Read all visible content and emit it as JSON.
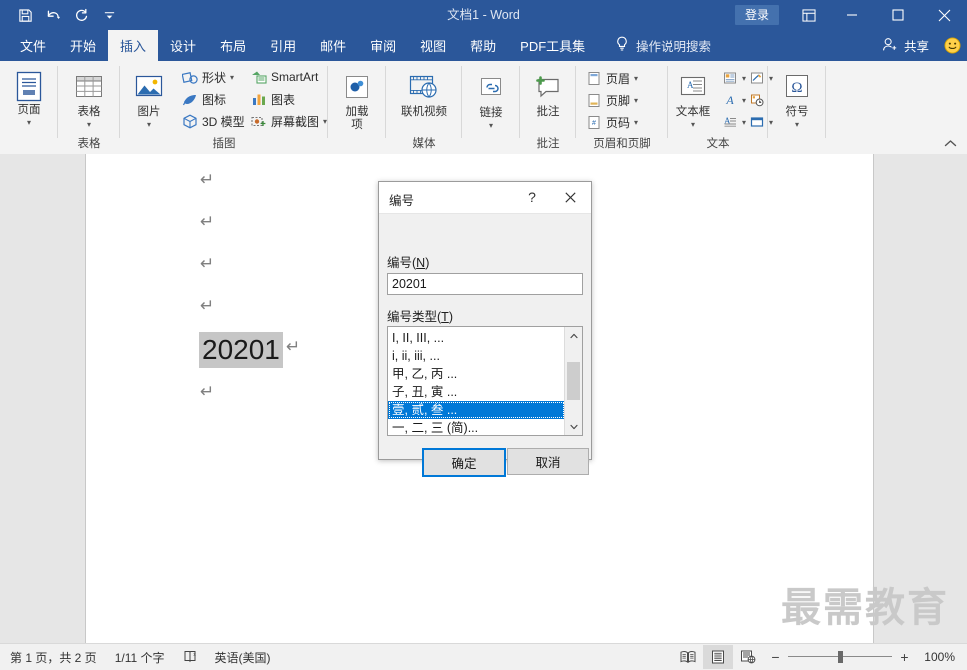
{
  "titlebar": {
    "document_title": "文档1  -  Word",
    "signin_label": "登录",
    "quick_access": [
      {
        "name": "save",
        "label": "保存"
      },
      {
        "name": "undo",
        "label": "撤消"
      },
      {
        "name": "redo",
        "label": "恢复"
      },
      {
        "name": "customize",
        "label": "自定义快速访问工具栏"
      }
    ],
    "ribbon_display_label": "功能区显示选项",
    "minimize_label": "最小化",
    "maximize_label": "最大化",
    "close_label": "关闭"
  },
  "tabs": [
    {
      "label": "文件",
      "active": false
    },
    {
      "label": "开始",
      "active": false
    },
    {
      "label": "插入",
      "active": true
    },
    {
      "label": "设计",
      "active": false
    },
    {
      "label": "布局",
      "active": false
    },
    {
      "label": "引用",
      "active": false
    },
    {
      "label": "邮件",
      "active": false
    },
    {
      "label": "审阅",
      "active": false
    },
    {
      "label": "视图",
      "active": false
    },
    {
      "label": "帮助",
      "active": false
    },
    {
      "label": "PDF工具集",
      "active": false
    }
  ],
  "tellme": {
    "placeholder": "操作说明搜索"
  },
  "share": {
    "label": "共享"
  },
  "ribbon": {
    "groups": [
      {
        "name": "pages",
        "label": "",
        "big": [
          {
            "name": "pages-button",
            "label": "页面",
            "caret": "▾"
          }
        ]
      },
      {
        "name": "tables",
        "label": "表格",
        "big": [
          {
            "name": "table-button",
            "label": "表格",
            "caret": "▾"
          }
        ]
      },
      {
        "name": "illustrations",
        "label": "插图",
        "big": [
          {
            "name": "pictures-button",
            "label": "图片",
            "caret": "▾"
          }
        ],
        "small": [
          {
            "name": "shapes",
            "label": "形状",
            "caret": "▾"
          },
          {
            "name": "smartart",
            "label": "SmartArt",
            "caret": ""
          },
          {
            "name": "icons",
            "label": "图标",
            "caret": ""
          },
          {
            "name": "chart",
            "label": "图表",
            "caret": ""
          },
          {
            "name": "model-3d",
            "label": "3D 模型",
            "caret": ""
          },
          {
            "name": "screenshot",
            "label": "屏幕截图",
            "caret": "▾"
          }
        ]
      },
      {
        "name": "addins",
        "label": "",
        "big": [
          {
            "name": "addins-button",
            "label": "加载项",
            "caret": "▾"
          }
        ]
      },
      {
        "name": "media",
        "label": "媒体",
        "big": [
          {
            "name": "online-video-button",
            "label": "联机视频",
            "caret": ""
          }
        ]
      },
      {
        "name": "links",
        "label": "",
        "big": [
          {
            "name": "link-button",
            "label": "链接",
            "caret": "▾"
          }
        ]
      },
      {
        "name": "comments",
        "label": "批注",
        "big": [
          {
            "name": "comment-button",
            "label": "批注",
            "caret": ""
          }
        ]
      },
      {
        "name": "header-footer",
        "label": "页眉和页脚",
        "small": [
          {
            "name": "header",
            "label": "页眉",
            "caret": "▾"
          },
          {
            "name": "footer",
            "label": "页脚",
            "caret": "▾"
          },
          {
            "name": "page-number",
            "label": "页码",
            "caret": "▾"
          }
        ]
      },
      {
        "name": "text",
        "label": "文本",
        "big": [
          {
            "name": "text-box-button",
            "label": "文本框",
            "caret": "▾"
          }
        ]
      },
      {
        "name": "symbols",
        "label": "",
        "big": [
          {
            "name": "symbol-button",
            "label": "符号",
            "caret": "▾"
          }
        ]
      }
    ],
    "collapse_label": "折叠功能区"
  },
  "document": {
    "text_line": "20201",
    "paragraph_mark": "↵",
    "watermark": "最需教育"
  },
  "dialog": {
    "title": "编号",
    "help_label": "?",
    "close_label": "✕",
    "number_field_label_prefix": "编号(",
    "number_field_label_key": "N",
    "number_field_label_suffix": ")",
    "number_value": "20201",
    "type_field_label_prefix": "编号类型(",
    "type_field_label_key": "T",
    "type_field_label_suffix": ")",
    "number_types": [
      {
        "label": "I, II, III, ...",
        "selected": false
      },
      {
        "label": "i, ii, iii, ...",
        "selected": false
      },
      {
        "label": "甲, 乙, 丙 ...",
        "selected": false
      },
      {
        "label": "子, 丑, 寅 ...",
        "selected": false
      },
      {
        "label": "壹, 贰, 叁 ...",
        "selected": true
      },
      {
        "label": "一, 二, 三 (简)...",
        "selected": false
      }
    ],
    "ok_label": "确定",
    "cancel_label": "取消"
  },
  "statusbar": {
    "page_info": "第 1 页，共 2 页",
    "word_count": "1/11 个字",
    "proofing_label": "校对",
    "language": "英语(美国)",
    "views": [
      {
        "name": "read-mode",
        "label": "阅读视图",
        "active": false
      },
      {
        "name": "print-layout",
        "label": "页面视图",
        "active": true
      },
      {
        "name": "web-layout",
        "label": "Web 版式视图",
        "active": false
      }
    ],
    "zoom_out_label": "−",
    "zoom_in_label": "+",
    "zoom_level": "100%"
  },
  "colors": {
    "word_blue": "#2b579a",
    "accent_blue": "#0078d7",
    "ribbon_bg": "#f3f3f3",
    "canvas_bg": "#e6e6e6"
  }
}
